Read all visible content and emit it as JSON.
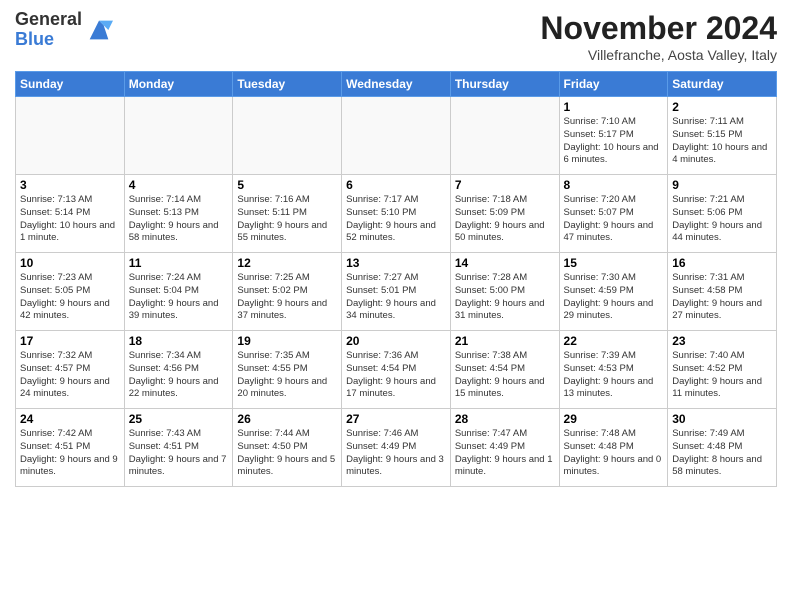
{
  "logo": {
    "general": "General",
    "blue": "Blue"
  },
  "header": {
    "month_title": "November 2024",
    "location": "Villefranche, Aosta Valley, Italy"
  },
  "weekdays": [
    "Sunday",
    "Monday",
    "Tuesday",
    "Wednesday",
    "Thursday",
    "Friday",
    "Saturday"
  ],
  "weeks": [
    [
      {
        "day": "",
        "info": ""
      },
      {
        "day": "",
        "info": ""
      },
      {
        "day": "",
        "info": ""
      },
      {
        "day": "",
        "info": ""
      },
      {
        "day": "",
        "info": ""
      },
      {
        "day": "1",
        "info": "Sunrise: 7:10 AM\nSunset: 5:17 PM\nDaylight: 10 hours and 6 minutes."
      },
      {
        "day": "2",
        "info": "Sunrise: 7:11 AM\nSunset: 5:15 PM\nDaylight: 10 hours and 4 minutes."
      }
    ],
    [
      {
        "day": "3",
        "info": "Sunrise: 7:13 AM\nSunset: 5:14 PM\nDaylight: 10 hours and 1 minute."
      },
      {
        "day": "4",
        "info": "Sunrise: 7:14 AM\nSunset: 5:13 PM\nDaylight: 9 hours and 58 minutes."
      },
      {
        "day": "5",
        "info": "Sunrise: 7:16 AM\nSunset: 5:11 PM\nDaylight: 9 hours and 55 minutes."
      },
      {
        "day": "6",
        "info": "Sunrise: 7:17 AM\nSunset: 5:10 PM\nDaylight: 9 hours and 52 minutes."
      },
      {
        "day": "7",
        "info": "Sunrise: 7:18 AM\nSunset: 5:09 PM\nDaylight: 9 hours and 50 minutes."
      },
      {
        "day": "8",
        "info": "Sunrise: 7:20 AM\nSunset: 5:07 PM\nDaylight: 9 hours and 47 minutes."
      },
      {
        "day": "9",
        "info": "Sunrise: 7:21 AM\nSunset: 5:06 PM\nDaylight: 9 hours and 44 minutes."
      }
    ],
    [
      {
        "day": "10",
        "info": "Sunrise: 7:23 AM\nSunset: 5:05 PM\nDaylight: 9 hours and 42 minutes."
      },
      {
        "day": "11",
        "info": "Sunrise: 7:24 AM\nSunset: 5:04 PM\nDaylight: 9 hours and 39 minutes."
      },
      {
        "day": "12",
        "info": "Sunrise: 7:25 AM\nSunset: 5:02 PM\nDaylight: 9 hours and 37 minutes."
      },
      {
        "day": "13",
        "info": "Sunrise: 7:27 AM\nSunset: 5:01 PM\nDaylight: 9 hours and 34 minutes."
      },
      {
        "day": "14",
        "info": "Sunrise: 7:28 AM\nSunset: 5:00 PM\nDaylight: 9 hours and 31 minutes."
      },
      {
        "day": "15",
        "info": "Sunrise: 7:30 AM\nSunset: 4:59 PM\nDaylight: 9 hours and 29 minutes."
      },
      {
        "day": "16",
        "info": "Sunrise: 7:31 AM\nSunset: 4:58 PM\nDaylight: 9 hours and 27 minutes."
      }
    ],
    [
      {
        "day": "17",
        "info": "Sunrise: 7:32 AM\nSunset: 4:57 PM\nDaylight: 9 hours and 24 minutes."
      },
      {
        "day": "18",
        "info": "Sunrise: 7:34 AM\nSunset: 4:56 PM\nDaylight: 9 hours and 22 minutes."
      },
      {
        "day": "19",
        "info": "Sunrise: 7:35 AM\nSunset: 4:55 PM\nDaylight: 9 hours and 20 minutes."
      },
      {
        "day": "20",
        "info": "Sunrise: 7:36 AM\nSunset: 4:54 PM\nDaylight: 9 hours and 17 minutes."
      },
      {
        "day": "21",
        "info": "Sunrise: 7:38 AM\nSunset: 4:54 PM\nDaylight: 9 hours and 15 minutes."
      },
      {
        "day": "22",
        "info": "Sunrise: 7:39 AM\nSunset: 4:53 PM\nDaylight: 9 hours and 13 minutes."
      },
      {
        "day": "23",
        "info": "Sunrise: 7:40 AM\nSunset: 4:52 PM\nDaylight: 9 hours and 11 minutes."
      }
    ],
    [
      {
        "day": "24",
        "info": "Sunrise: 7:42 AM\nSunset: 4:51 PM\nDaylight: 9 hours and 9 minutes."
      },
      {
        "day": "25",
        "info": "Sunrise: 7:43 AM\nSunset: 4:51 PM\nDaylight: 9 hours and 7 minutes."
      },
      {
        "day": "26",
        "info": "Sunrise: 7:44 AM\nSunset: 4:50 PM\nDaylight: 9 hours and 5 minutes."
      },
      {
        "day": "27",
        "info": "Sunrise: 7:46 AM\nSunset: 4:49 PM\nDaylight: 9 hours and 3 minutes."
      },
      {
        "day": "28",
        "info": "Sunrise: 7:47 AM\nSunset: 4:49 PM\nDaylight: 9 hours and 1 minute."
      },
      {
        "day": "29",
        "info": "Sunrise: 7:48 AM\nSunset: 4:48 PM\nDaylight: 9 hours and 0 minutes."
      },
      {
        "day": "30",
        "info": "Sunrise: 7:49 AM\nSunset: 4:48 PM\nDaylight: 8 hours and 58 minutes."
      }
    ]
  ]
}
